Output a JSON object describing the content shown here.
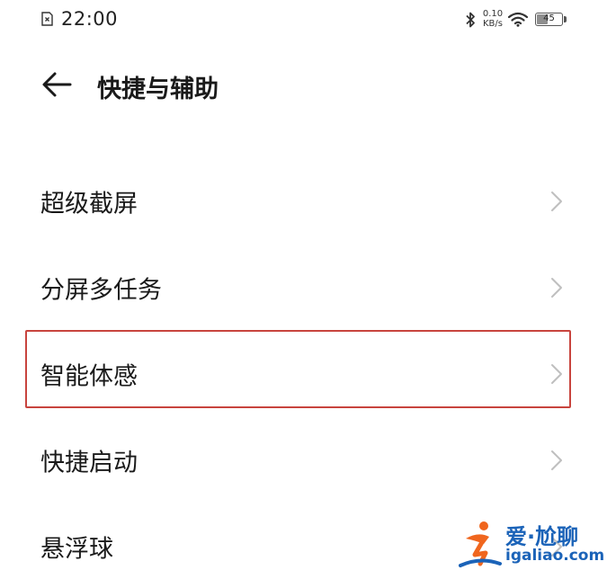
{
  "status_bar": {
    "time": "22:00",
    "net_speed_value": "0.10",
    "net_speed_unit": "KB/s",
    "battery_level": "45",
    "battery_fraction": 0.45,
    "icons": [
      "sim-icon",
      "bluetooth-icon",
      "wifi-icon",
      "battery-icon"
    ]
  },
  "header": {
    "back_icon": "back-arrow-icon",
    "title": "快捷与辅助"
  },
  "menu": {
    "items": [
      {
        "label": "超级截屏"
      },
      {
        "label": "分屏多任务"
      },
      {
        "label": "智能体感",
        "highlighted": true
      },
      {
        "label": "快捷启动"
      },
      {
        "label": "悬浮球"
      }
    ],
    "chevron_icon": "chevron-right-icon"
  },
  "watermark": {
    "title": "爱·尬聊",
    "url": "igaliao.com"
  },
  "colors": {
    "highlight_border": "#c8443e",
    "chevron": "#bfbfbf",
    "watermark_blue": "#1b63b8",
    "watermark_orange": "#f0661e"
  }
}
